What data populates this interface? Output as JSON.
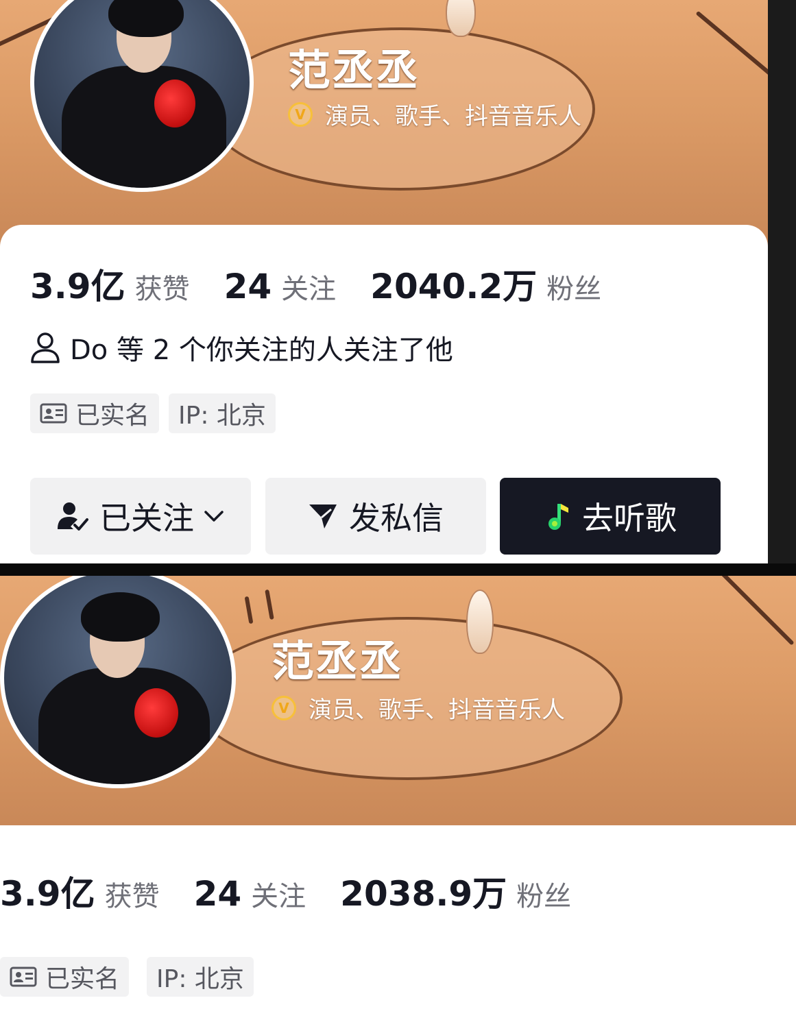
{
  "top_profile": {
    "username": "范丞丞",
    "verification": "演员、歌手、抖音音乐人",
    "stats": {
      "likes_value": "3.9亿",
      "likes_label": "获赞",
      "following_value": "24",
      "following_label": "关注",
      "followers_value": "2040.2万",
      "followers_label": "粉丝"
    },
    "mutual_follow": "Do 等 2 个你关注的人关注了他",
    "tags": {
      "realname": "已实名",
      "ip": "IP:  北京"
    },
    "buttons": {
      "following": "已关注",
      "message": "发私信",
      "music": "去听歌"
    }
  },
  "bottom_profile": {
    "username": "范丞丞",
    "verification": "演员、歌手、抖音音乐人",
    "stats": {
      "likes_value": "3.9亿",
      "likes_label": "获赞",
      "following_value": "24",
      "following_label": "关注",
      "followers_value": "2038.9万",
      "followers_label": "粉丝"
    },
    "tags": {
      "realname": "已实名",
      "ip": "IP:  北京"
    }
  },
  "colors": {
    "banner": "#dc9b66",
    "verify_badge": "#f7c03a",
    "dark_button": "#161823",
    "text_primary": "#161823",
    "text_secondary": "#6f7078"
  },
  "icons": [
    "verified-badge-icon",
    "user-outline-icon",
    "id-card-icon",
    "user-check-icon",
    "chevron-down-icon",
    "send-icon",
    "music-note-icon"
  ]
}
